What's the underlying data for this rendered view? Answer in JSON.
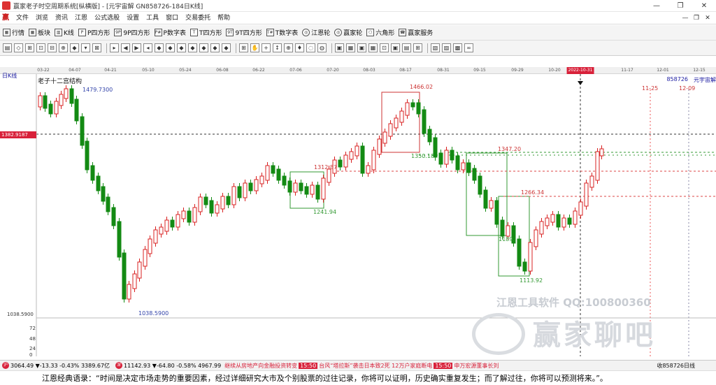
{
  "window": {
    "title": "赢家老子时空周期系统[纵横版] - [元宇宙解  GN858726-184日K线]",
    "btn_min": "—",
    "btn_max": "❐",
    "btn_close": "✕"
  },
  "menu": {
    "items": [
      "文件",
      "浏览",
      "资讯",
      "江恩",
      "公式选股",
      "设置",
      "工具",
      "窗口",
      "交易委托",
      "帮助"
    ],
    "mdi_min": "—",
    "mdi_restore": "❐",
    "mdi_close": "✕"
  },
  "toolbar1": {
    "items": [
      {
        "icon": "chart-bars-icon",
        "glyph": "▦",
        "label": "行情"
      },
      {
        "icon": "grid-icon",
        "glyph": "▦",
        "label": "板块"
      },
      {
        "icon": "candle-icon",
        "glyph": "▥",
        "label": "K线"
      },
      {
        "icon": "p-square-icon",
        "glyph": "P",
        "label": "P四方形"
      },
      {
        "icon": "9p-square-icon",
        "glyph": "9P",
        "label": "9P四方形"
      },
      {
        "icon": "p-number-icon",
        "glyph": "P#",
        "label": "P数字表"
      },
      {
        "icon": "t-square-icon",
        "glyph": "T",
        "label": "T四方形"
      },
      {
        "icon": "9t-square-icon",
        "glyph": "9T",
        "label": "9T四方形"
      },
      {
        "icon": "t-number-icon",
        "glyph": "T#",
        "label": "T数字表"
      },
      {
        "icon": "gann-wheel-icon",
        "glyph": "◎",
        "label": "江恩轮"
      },
      {
        "icon": "winner-wheel-icon",
        "glyph": "◎",
        "label": "赢家轮"
      },
      {
        "icon": "hexagon-icon",
        "glyph": "⬡",
        "label": "六角形"
      },
      {
        "icon": "service-icon",
        "glyph": "☎",
        "label": "赢家服务"
      }
    ]
  },
  "toolbar2": {
    "icons": [
      "▤",
      "◇",
      "⊞",
      "⊡",
      "⊟",
      "⊕",
      "◆",
      "▾",
      "⊠",
      "▸",
      "◀",
      "▶",
      "◂",
      "◆",
      "◆",
      "◆",
      "◆",
      "◆",
      "◆",
      "◆",
      "⊞",
      "✋",
      "+",
      "↕",
      "⊕",
      "♦",
      "◌",
      "◍",
      "▣",
      "▦",
      "▣",
      "▦",
      "⊡",
      "▣",
      "▤",
      "⊞",
      "▧",
      "▨",
      "▩",
      "∞"
    ]
  },
  "timeaxis": {
    "ticks": [
      {
        "label": "03-22",
        "x": 62
      },
      {
        "label": "04-07",
        "x": 107
      },
      {
        "label": "04-21",
        "x": 158
      },
      {
        "label": "05-10",
        "x": 212
      },
      {
        "label": "05-24",
        "x": 265
      },
      {
        "label": "06-08",
        "x": 318
      },
      {
        "label": "06-22",
        "x": 370
      },
      {
        "label": "07-06",
        "x": 423
      },
      {
        "label": "07-20",
        "x": 476
      },
      {
        "label": "08-03",
        "x": 528
      },
      {
        "label": "08-17",
        "x": 580
      },
      {
        "label": "08-31",
        "x": 634
      },
      {
        "label": "09-15",
        "x": 686
      },
      {
        "label": "09-29",
        "x": 740
      },
      {
        "label": "10-20",
        "x": 793
      },
      {
        "label": "2022-10-31",
        "x": 830,
        "highlight": true
      },
      {
        "label": "11-17",
        "x": 897
      },
      {
        "label": "12-01",
        "x": 948
      },
      {
        "label": "12-15",
        "x": 1000
      }
    ]
  },
  "chart": {
    "period_label": "日K线",
    "panel_label": "老子十二宫结构",
    "code": "858726",
    "name": "元宇宙解",
    "current_price_tag": "1382.9187",
    "date_labels": [
      "11-25",
      "12-09"
    ],
    "y_labels": [
      "1038.5900",
      "72",
      "48",
      "24",
      "0"
    ],
    "price_annotations": [
      "1479.7300",
      "1038.5900",
      "1466.02",
      "1350.18",
      "1312.87",
      "1241.94",
      "1347.20",
      "1266.34",
      "1189.",
      "1113.92"
    ]
  },
  "chart_data": {
    "type": "candlestick",
    "title": "老子十二宫结构",
    "ylim": [
      1038.59,
      1479.73
    ],
    "annotations": [
      {
        "label": "1479.7300",
        "value": 1479.73
      },
      {
        "label": "1038.5900",
        "value": 1038.59
      },
      {
        "label": "1466.02",
        "value": 1466.02
      },
      {
        "label": "1350.18",
        "value": 1350.18
      },
      {
        "label": "1312.87",
        "value": 1312.87
      },
      {
        "label": "1241.94",
        "value": 1241.94
      },
      {
        "label": "1347.20",
        "value": 1347.2
      },
      {
        "label": "1266.34",
        "value": 1266.34
      },
      {
        "label": "1113.92",
        "value": 1113.92
      }
    ],
    "current_price": 1382.9187,
    "volume_axis": [
      "72",
      "48",
      "24",
      "0"
    ]
  },
  "watermark": {
    "line1": "江恩工具软件  QQ:100800360",
    "line2": "赢家聊吧"
  },
  "statusbar": {
    "index1_icon": "沪",
    "index1": "3064.49 ▼-13.33 -0.43% 3389.67亿",
    "index2_icon": "深",
    "index2": "11142.93 ▼-64.80 -0.58% 4967.99",
    "news1": "继续从房地产向金融投资转变",
    "time1": "15:50",
    "news2": "台风“塔拉斯”袭击日本致2死 12万户家庭断电",
    "time2": "15:50",
    "news3": "申万宏源董事长刘",
    "right": "收858726日线"
  },
  "bottom": {
    "quote": "江恩经典语录：“时间是决定市场走势的重要因素，经过详细研究大市及个别股票的过往记录，你将可以证明，历史确实重复发生；而了解过往，你将可以预测将来。”。"
  }
}
